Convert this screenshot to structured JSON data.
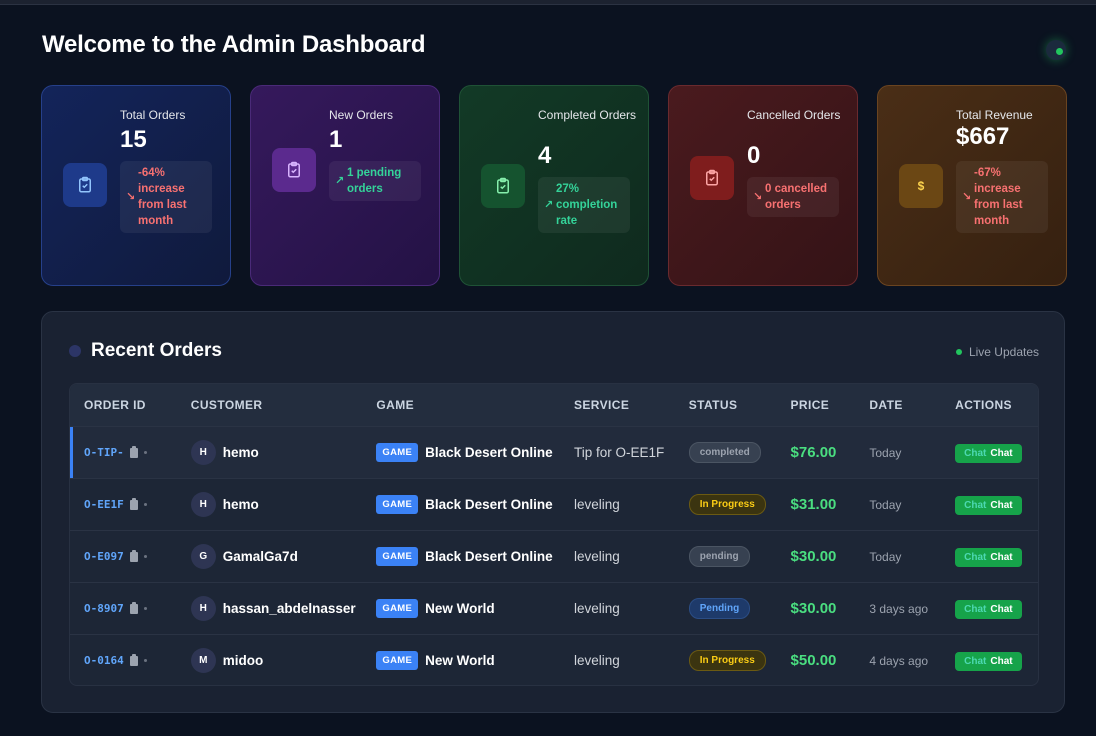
{
  "header": {
    "title": "Welcome to the Admin Dashboard"
  },
  "cards": [
    {
      "label": "Total Orders",
      "value": "15",
      "note": "-64% increase from last month",
      "trend": "down"
    },
    {
      "label": "New Orders",
      "value": "1",
      "note": "1 pending orders",
      "trend": "up"
    },
    {
      "label": "Completed Orders",
      "value": "4",
      "note": "27% completion rate",
      "trend": "up"
    },
    {
      "label": "Cancelled Orders",
      "value": "0",
      "note": "0 cancelled orders",
      "trend": "down"
    },
    {
      "label": "Total Revenue",
      "value": "$667",
      "note": "-67% increase from last month",
      "trend": "down",
      "icon_text": "$"
    }
  ],
  "recent_orders": {
    "title": "Recent Orders",
    "live_label": "Live Updates",
    "columns": [
      "ORDER ID",
      "CUSTOMER",
      "GAME",
      "SERVICE",
      "STATUS",
      "PRICE",
      "DATE",
      "ACTIONS"
    ],
    "game_badge": "GAME",
    "action_ghost": "Chat",
    "action_label": "Chat",
    "rows": [
      {
        "id": "O-TIP-",
        "initial": "H",
        "customer": "hemo",
        "game": "Black Desert Online",
        "service": "Tip for O-EE1F",
        "status": "completed",
        "price": "$76.00",
        "date": "Today"
      },
      {
        "id": "O-EE1F",
        "initial": "H",
        "customer": "hemo",
        "game": "Black Desert Online",
        "service": "leveling",
        "status": "In Progress",
        "price": "$31.00",
        "date": "Today"
      },
      {
        "id": "O-E097",
        "initial": "G",
        "customer": "GamalGa7d",
        "game": "Black Desert Online",
        "service": "leveling",
        "status": "pending",
        "price": "$30.00",
        "date": "Today"
      },
      {
        "id": "O-8907",
        "initial": "H",
        "customer": "hassan_abdelnasser",
        "game": "New World",
        "service": "leveling",
        "status": "Pending",
        "price": "$30.00",
        "date": "3 days ago"
      },
      {
        "id": "O-0164",
        "initial": "M",
        "customer": "midoo",
        "game": "New World",
        "service": "leveling",
        "status": "In Progress",
        "price": "$50.00",
        "date": "4 days ago"
      }
    ]
  },
  "colors": {
    "accent": "#3b82f6",
    "success": "#22c55e",
    "price": "#4ade80",
    "danger": "#f87171"
  }
}
